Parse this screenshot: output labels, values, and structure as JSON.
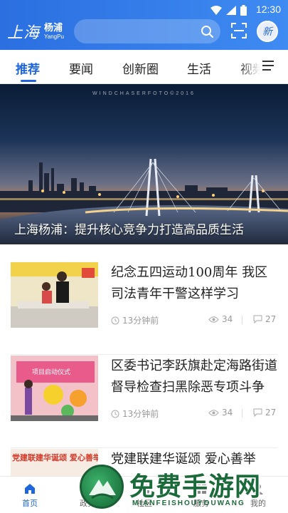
{
  "status_bar": {
    "time": "12:30"
  },
  "header": {
    "logo_main": "上海",
    "logo_district": "杨浦",
    "logo_english": "YangPu",
    "search_placeholder": "",
    "avatar_glyph": "新"
  },
  "tabs": [
    {
      "label": "推荐",
      "active": true
    },
    {
      "label": "要闻",
      "active": false
    },
    {
      "label": "创新圈",
      "active": false
    },
    {
      "label": "生活",
      "active": false
    },
    {
      "label": "视频",
      "active": false
    }
  ],
  "banner": {
    "watermark": "WINDCHASERFOTO©2016",
    "caption": "上海杨浦：提升核心竞争力打造高品质生活"
  },
  "news": [
    {
      "title": "纪念五四运动100周年 我区司法青年干警这样学习",
      "time": "13分钟前",
      "views": "34",
      "comments": "27"
    },
    {
      "title": "区委书记李跃旗赴定海路街道督导检查扫黑除恶专项斗争",
      "time": "13分钟前",
      "views": "34",
      "comments": "27"
    },
    {
      "title": "党建联建华诞颂 爱心善举",
      "thumb_text": "党建联建华诞颂 爱心善举"
    }
  ],
  "thumb_texts": {
    "second": "项目启动仪式"
  },
  "bottom_nav": [
    {
      "label": "首页",
      "active": true
    },
    {
      "label": "政务",
      "active": false
    },
    {
      "label": "社区",
      "active": false
    },
    {
      "label": "服务",
      "active": false
    },
    {
      "label": "我的",
      "active": false
    }
  ],
  "overlay": {
    "title": "免费手游网",
    "subtitle": "MIANFEISHOUYOUWANG"
  },
  "colors": {
    "brand": "#2b6fe0",
    "active_tab": "#1f66dd",
    "meta": "#9a9a9a"
  }
}
